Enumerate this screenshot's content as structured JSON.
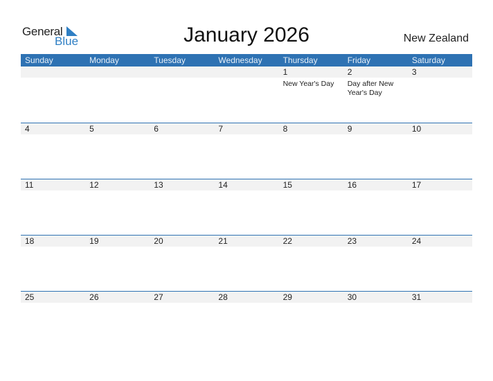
{
  "logo": {
    "line1": "General",
    "line2": "Blue"
  },
  "title": "January 2026",
  "country": "New Zealand",
  "colors": {
    "header_bg": "#2e72b3",
    "date_strip": "#f2f2f2",
    "brand_blue": "#2f7fc4"
  },
  "weekdays": [
    "Sunday",
    "Monday",
    "Tuesday",
    "Wednesday",
    "Thursday",
    "Friday",
    "Saturday"
  ],
  "weeks": [
    {
      "dates": [
        "",
        "",
        "",
        "",
        "1",
        "2",
        "3"
      ],
      "events": [
        "",
        "",
        "",
        "",
        "New Year's Day",
        "Day after New Year's Day",
        ""
      ]
    },
    {
      "dates": [
        "4",
        "5",
        "6",
        "7",
        "8",
        "9",
        "10"
      ],
      "events": [
        "",
        "",
        "",
        "",
        "",
        "",
        ""
      ]
    },
    {
      "dates": [
        "11",
        "12",
        "13",
        "14",
        "15",
        "16",
        "17"
      ],
      "events": [
        "",
        "",
        "",
        "",
        "",
        "",
        ""
      ]
    },
    {
      "dates": [
        "18",
        "19",
        "20",
        "21",
        "22",
        "23",
        "24"
      ],
      "events": [
        "",
        "",
        "",
        "",
        "",
        "",
        ""
      ]
    },
    {
      "dates": [
        "25",
        "26",
        "27",
        "28",
        "29",
        "30",
        "31"
      ],
      "events": [
        "",
        "",
        "",
        "",
        "",
        "",
        ""
      ]
    }
  ]
}
